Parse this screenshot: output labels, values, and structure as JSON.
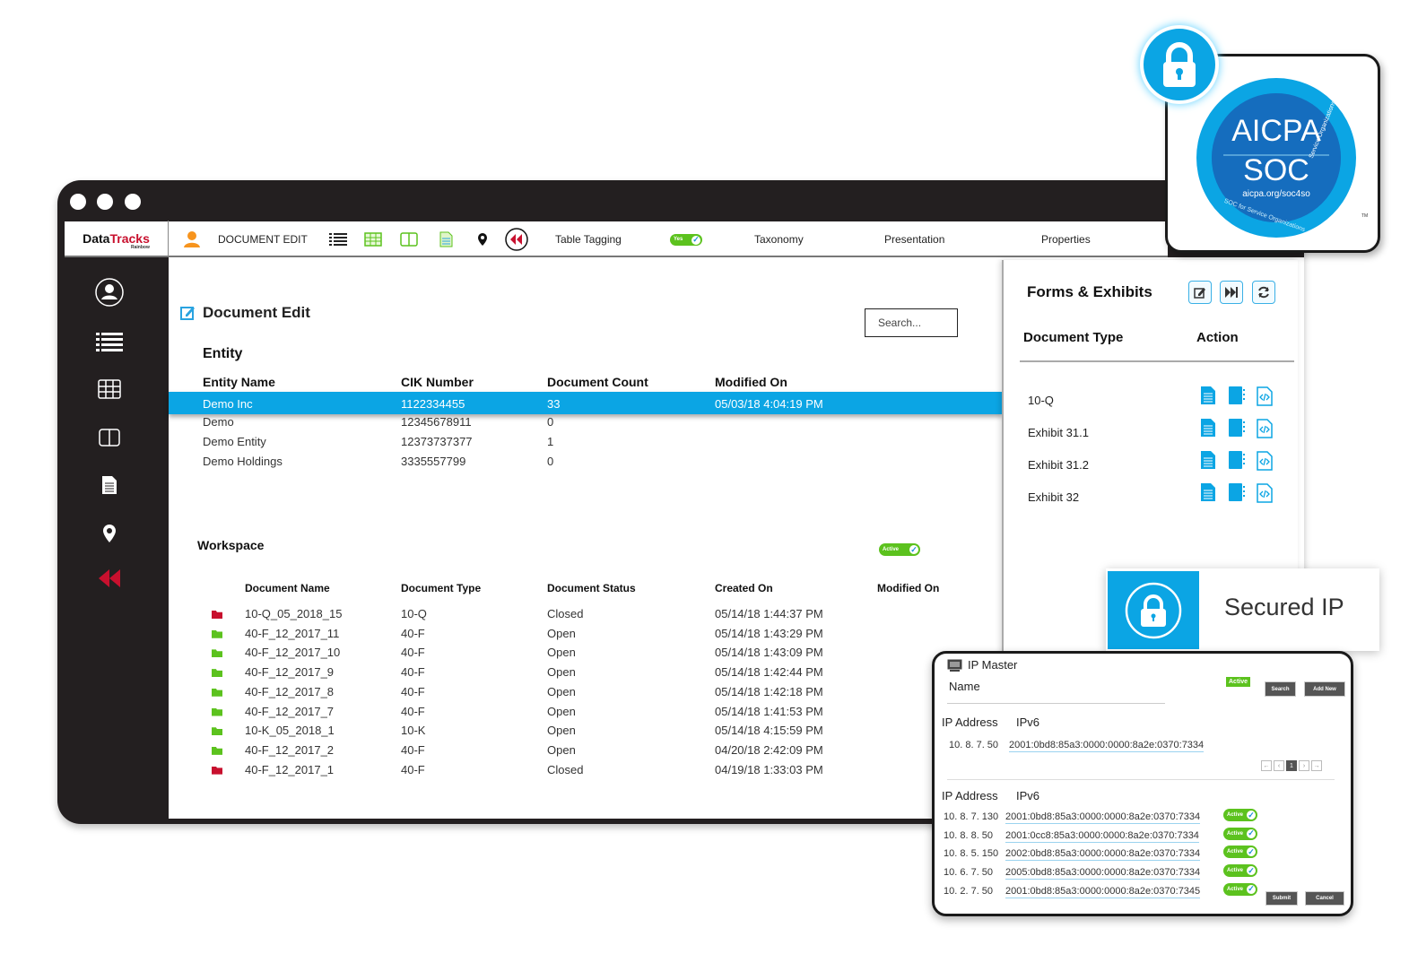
{
  "app": {
    "logo_main": "Data",
    "logo_accent": "Tracks",
    "logo_sub": "Rainbow"
  },
  "toolbar": {
    "title": "DOCUMENT EDIT",
    "table_tagging_label": "Table Tagging",
    "table_tagging_toggle": "Yes",
    "taxonomy": "Taxonomy",
    "presentation": "Presentation",
    "properties": "Properties"
  },
  "document_edit": {
    "title": "Document Edit",
    "search_placeholder": "Search...",
    "entity_section": "Entity",
    "entity_columns": [
      "Entity Name",
      "CIK Number",
      "Document Count",
      "Modified On"
    ],
    "entities": [
      {
        "name": "Demo Inc",
        "cik": "1122334455",
        "count": "33",
        "modified": "05/03/18 4:04:19 PM",
        "selected": true
      },
      {
        "name": "Demo",
        "cik": "12345678911",
        "count": "0",
        "modified": ""
      },
      {
        "name": "Demo Entity",
        "cik": "12373737377",
        "count": "1",
        "modified": ""
      },
      {
        "name": "Demo Holdings",
        "cik": "3335557799",
        "count": "0",
        "modified": ""
      }
    ]
  },
  "workspace": {
    "title": "Workspace",
    "toggle": "Active",
    "columns": [
      "Document Name",
      "Document Type",
      "Document Status",
      "Created On",
      "Modified On"
    ],
    "rows": [
      {
        "name": "10-Q_05_2018_15",
        "type": "10-Q",
        "status": "Closed",
        "created": "05/14/18 1:44:37 PM"
      },
      {
        "name": "40-F_12_2017_11",
        "type": "40-F",
        "status": "Open",
        "created": "05/14/18 1:43:29 PM"
      },
      {
        "name": "40-F_12_2017_10",
        "type": "40-F",
        "status": "Open",
        "created": "05/14/18 1:43:09 PM"
      },
      {
        "name": "40-F_12_2017_9",
        "type": "40-F",
        "status": "Open",
        "created": "05/14/18 1:42:44 PM"
      },
      {
        "name": "40-F_12_2017_8",
        "type": "40-F",
        "status": "Open",
        "created": "05/14/18 1:42:18 PM"
      },
      {
        "name": "40-F_12_2017_7",
        "type": "40-F",
        "status": "Open",
        "created": "05/14/18 1:41:53 PM"
      },
      {
        "name": "10-K_05_2018_1",
        "type": "10-K",
        "status": "Open",
        "created": "05/14/18 4:15:59 PM"
      },
      {
        "name": "40-F_12_2017_2",
        "type": "40-F",
        "status": "Open",
        "created": "04/20/18 2:42:09 PM"
      },
      {
        "name": "40-F_12_2017_1",
        "type": "40-F",
        "status": "Closed",
        "created": "04/19/18 1:33:03 PM"
      }
    ],
    "status_colors": {
      "Open": "#5cc21e",
      "Closed": "#c8102e"
    }
  },
  "forms_exhibits": {
    "title": "Forms & Exhibits",
    "col_type": "Document Type",
    "col_action": "Action",
    "rows": [
      "10-Q",
      "Exhibit 31.1",
      "Exhibit 31.2",
      "Exhibit 32"
    ]
  },
  "soc_badge": {
    "line1": "AICPA",
    "line2": "SOC",
    "url": "aicpa.org/soc4so",
    "ring_left": "SOC for Service Organizations",
    "ring_right": "Service Organizations",
    "tm": "TM"
  },
  "secured_ip": {
    "label": "Secured IP"
  },
  "ip_master": {
    "title": "IP Master",
    "name_label": "Name",
    "active_badge": "Active",
    "search_button": "Search",
    "add_new_button": "Add New",
    "col_ip": "IP Address",
    "col_ipv6": "IPv6",
    "top_row": {
      "ip": "10. 8. 7. 50",
      "ipv6": "2001:0bd8:85a3:0000:0000:8a2e:0370:7334"
    },
    "pagination": {
      "first": "←",
      "prev": "‹",
      "current": "1",
      "next": "›",
      "last": "→"
    },
    "rows": [
      {
        "ip": "10. 8. 7. 130",
        "ipv6": "2001:0bd8:85a3:0000:0000:8a2e:0370:7334",
        "status": "Active"
      },
      {
        "ip": "10. 8. 8. 50",
        "ipv6": "2001:0cc8:85a3:0000:0000:8a2e:0370:7334",
        "status": "Active"
      },
      {
        "ip": "10. 8. 5. 150",
        "ipv6": "2002:0bd8:85a3:0000:0000:8a2e:0370:7334",
        "status": "Active"
      },
      {
        "ip": "10. 6. 7. 50",
        "ipv6": "2005:0bd8:85a3:0000:0000:8a2e:0370:7334",
        "status": "Active"
      },
      {
        "ip": "10. 2. 7. 50",
        "ipv6": "2001:0bd8:85a3:0000:0000:8a2e:0370:7345",
        "status": "Active"
      }
    ],
    "submit_button": "Submit",
    "cancel_button": "Cancel"
  }
}
